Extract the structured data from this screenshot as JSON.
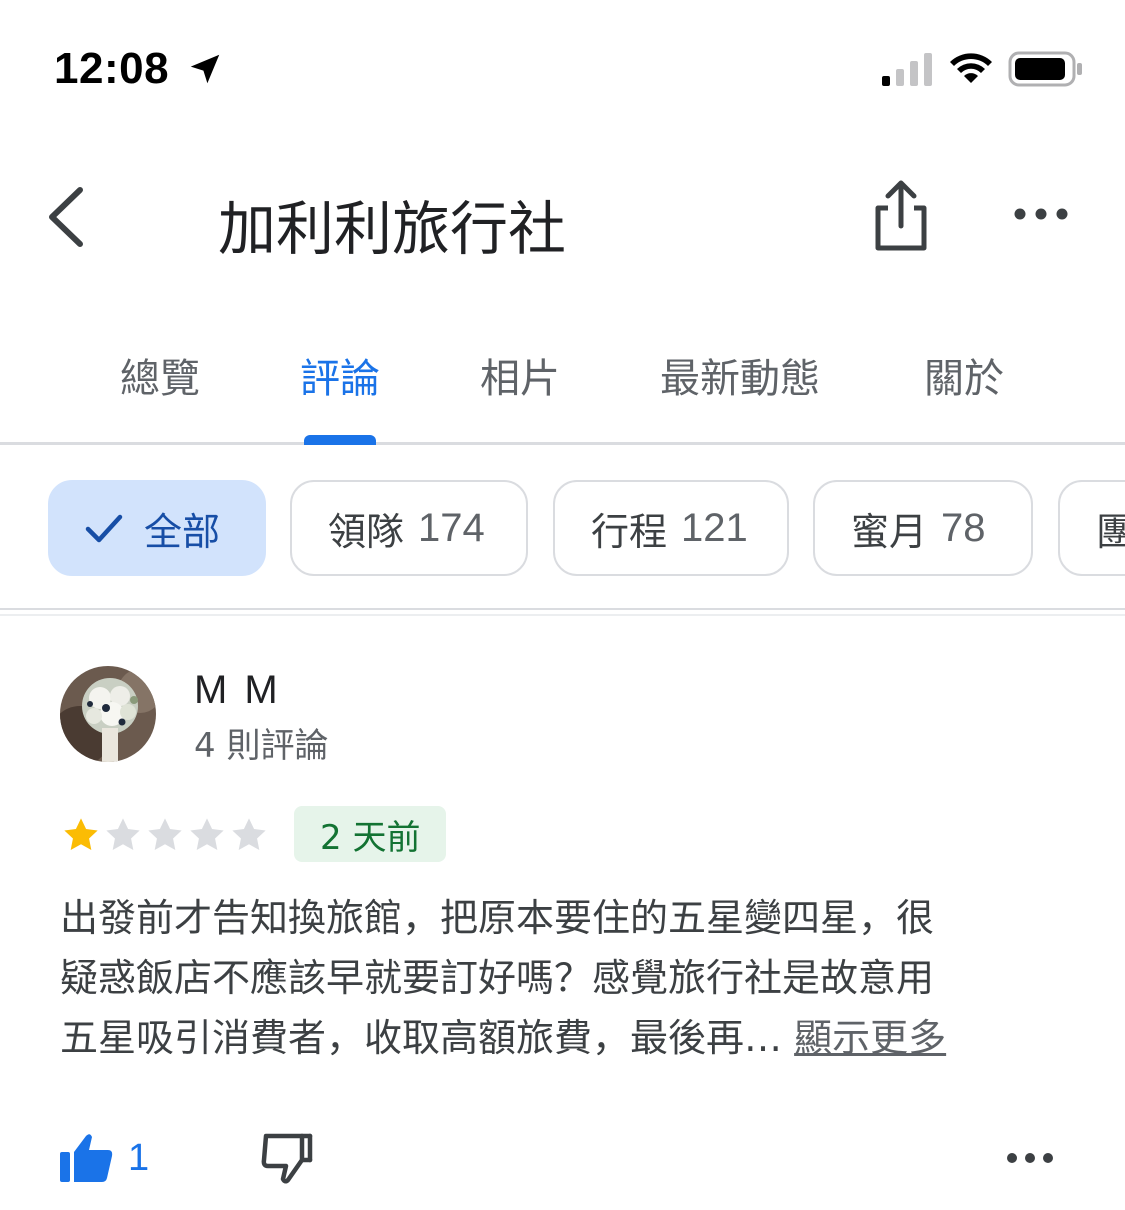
{
  "status_bar": {
    "time": "12:08",
    "icons": [
      "location-arrow-icon",
      "cellular-signal-icon",
      "wifi-icon",
      "battery-icon"
    ]
  },
  "header": {
    "title": "加利利旅行社",
    "icons": [
      "back-chevron-icon",
      "share-icon",
      "more-horizontal-icon"
    ]
  },
  "tabs": [
    {
      "label": "總覽",
      "active": false
    },
    {
      "label": "評論",
      "active": true
    },
    {
      "label": "相片",
      "active": false
    },
    {
      "label": "最新動態",
      "active": false
    },
    {
      "label": "關於",
      "active": false
    }
  ],
  "filter_chips": [
    {
      "label": "全部",
      "count": "",
      "selected": true
    },
    {
      "label": "領隊",
      "count": "174",
      "selected": false
    },
    {
      "label": "行程",
      "count": "121",
      "selected": false
    },
    {
      "label": "蜜月",
      "count": "78",
      "selected": false
    },
    {
      "label": "團",
      "count": "",
      "selected": false
    }
  ],
  "review": {
    "author": "M M",
    "meta": "4 則評論",
    "rating": 1,
    "max_rating": 5,
    "date": "2 天前",
    "text_lines": [
      "出發前才告知換旅館，把原本要住的五星變四星，很",
      "疑惑飯店不應該早就要訂好嗎？感覺旅行社是故意用",
      "五星吸引消費者，收取高額旅費，最後再…"
    ],
    "show_more": "顯示更多",
    "likes": "1"
  },
  "colors": {
    "accent": "#1a73e8",
    "selected_chip_bg": "#d2e3fc",
    "date_badge_bg": "#e6f4ea",
    "date_badge_text": "#137333",
    "star_filled": "#fbbc04",
    "star_empty": "#dadce0"
  }
}
